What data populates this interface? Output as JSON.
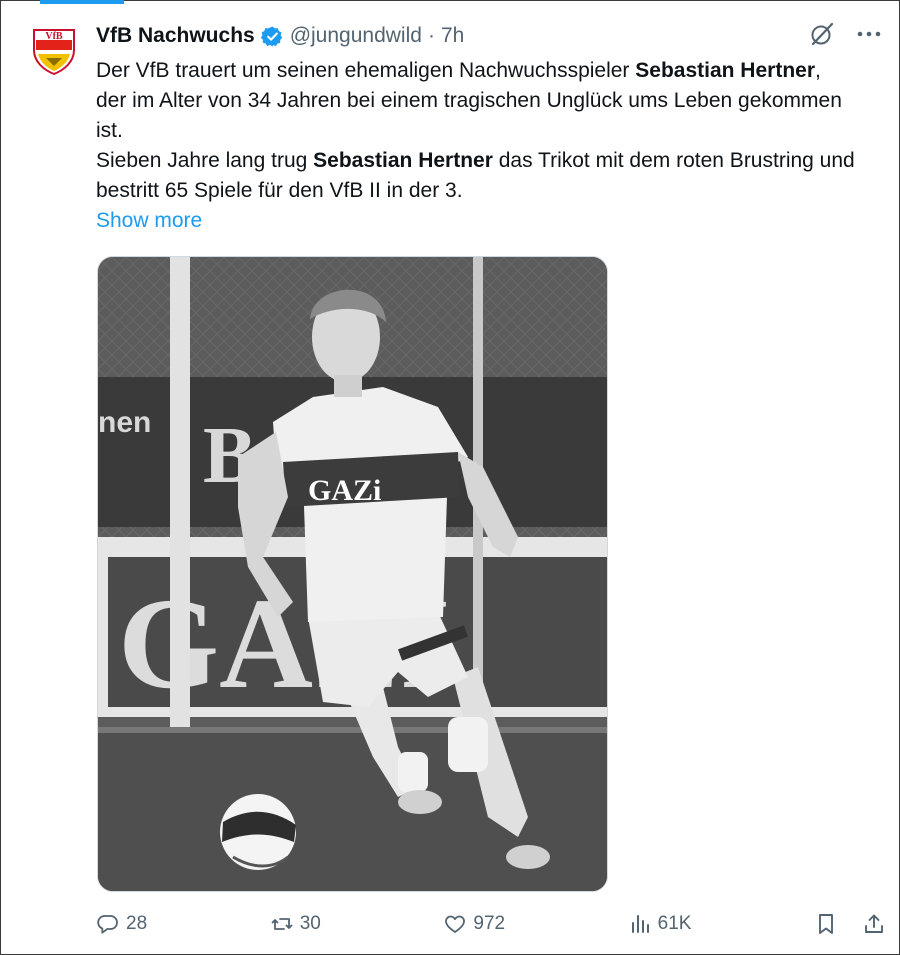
{
  "colors": {
    "accent": "#1d9bf0",
    "text_primary": "#0f1419",
    "text_secondary": "#536471"
  },
  "account": {
    "name": "VfB Nachwuchs",
    "handle": "@jungundwild",
    "separator": "·",
    "time": "7h",
    "logo_text": "VfB",
    "verified_icon": "verified-badge-icon"
  },
  "tweet": {
    "p1_a": "Der VfB trauert um seinen ehemaligen Nachwuchsspieler ",
    "p1_bold": "Sebastian Hertner",
    "p1_b": ", der im Alter von 34 Jahren bei einem tragischen Unglück ums Leben gekommen ist.",
    "p2_a": "Sieben Jahre lang trug ",
    "p2_bold": "Sebastian Hertner",
    "p2_b": " das Trikot mit dem roten Brustring und bestritt 65 Spiele für den VfB II in der 3.",
    "show_more": "Show more"
  },
  "media": {
    "shirt_sponsor": "GAZi",
    "board_text_1": "B   ER",
    "board_text_2": "GAZİ",
    "board_text_3": "nen"
  },
  "actions": {
    "replies": "28",
    "reposts": "30",
    "likes": "972",
    "views": "61K"
  }
}
